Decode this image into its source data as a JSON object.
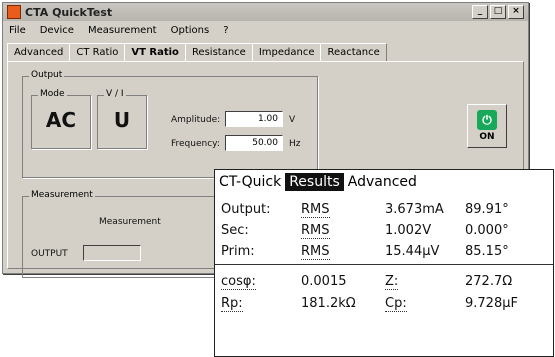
{
  "window": {
    "title": "CTA QuickTest",
    "menu": [
      "File",
      "Device",
      "Measurement",
      "Options",
      "?"
    ],
    "tabs": [
      "Advanced",
      "CT Ratio",
      "VT Ratio",
      "Resistance",
      "Impedance",
      "Reactance"
    ],
    "active_tab": "VT Ratio"
  },
  "output_group": {
    "label": "Output",
    "mode_label": "Mode",
    "mode_value": "AC",
    "vi_label": "V / I",
    "vi_value": "U",
    "amplitude_label": "Amplitude:",
    "amplitude_value": "1.00",
    "amplitude_unit": "V",
    "frequency_label": "Frequency:",
    "frequency_value": "50.00",
    "frequency_unit": "Hz",
    "on_label": "ON"
  },
  "measurement_group": {
    "label": "Measurement",
    "inner_label": "Measurement",
    "output_label": "OUTPUT"
  },
  "device": {
    "tabs": [
      "CT-Quick",
      "Results",
      "Advanced"
    ],
    "selected_tab_index": 1,
    "rows": [
      {
        "name": "Output:",
        "mode": "RMS",
        "value": "3.673mA",
        "angle": "89.91°"
      },
      {
        "name": "Sec:",
        "mode": "RMS",
        "value": "1.002V",
        "angle": "0.000°"
      },
      {
        "name": "Prim:",
        "mode": "RMS",
        "value": "15.44µV",
        "angle": "85.15°"
      }
    ],
    "extra": [
      {
        "label1": "cosφ:",
        "value1": "0.0015",
        "label2": "Z:",
        "value2": "272.7Ω"
      },
      {
        "label1": "Rp:",
        "value1": "181.2kΩ",
        "label2": "Cp:",
        "value2": "9.728µF"
      }
    ]
  }
}
